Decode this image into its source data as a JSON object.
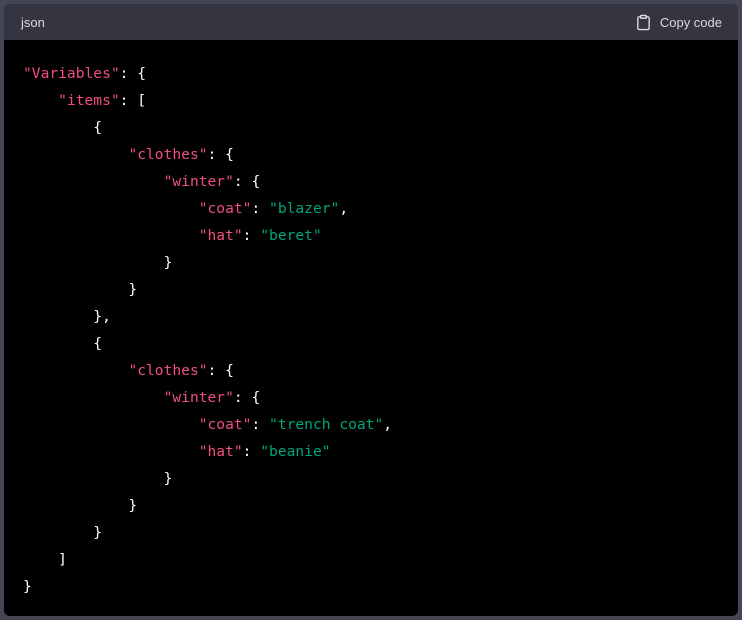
{
  "header": {
    "language": "json",
    "copy_label": "Copy code"
  },
  "icons": {
    "copy": "clipboard-icon"
  },
  "colors": {
    "key": "#ef4f7c",
    "string": "#00a67d",
    "punctuation": "#ffffff",
    "code_background": "#000000",
    "header_background": "#343541"
  },
  "code": {
    "lines": [
      [
        {
          "t": "k",
          "v": "\"Variables\""
        },
        {
          "t": "p",
          "v": ": {"
        }
      ],
      [
        {
          "t": "p",
          "v": "    "
        },
        {
          "t": "k",
          "v": "\"items\""
        },
        {
          "t": "p",
          "v": ": ["
        }
      ],
      [
        {
          "t": "p",
          "v": "        {"
        }
      ],
      [
        {
          "t": "p",
          "v": "            "
        },
        {
          "t": "k",
          "v": "\"clothes\""
        },
        {
          "t": "p",
          "v": ": {"
        }
      ],
      [
        {
          "t": "p",
          "v": "                "
        },
        {
          "t": "k",
          "v": "\"winter\""
        },
        {
          "t": "p",
          "v": ": {"
        }
      ],
      [
        {
          "t": "p",
          "v": "                    "
        },
        {
          "t": "k",
          "v": "\"coat\""
        },
        {
          "t": "p",
          "v": ": "
        },
        {
          "t": "s",
          "v": "\"blazer\""
        },
        {
          "t": "p",
          "v": ","
        }
      ],
      [
        {
          "t": "p",
          "v": "                    "
        },
        {
          "t": "k",
          "v": "\"hat\""
        },
        {
          "t": "p",
          "v": ": "
        },
        {
          "t": "s",
          "v": "\"beret\""
        }
      ],
      [
        {
          "t": "p",
          "v": "                }"
        }
      ],
      [
        {
          "t": "p",
          "v": "            }"
        }
      ],
      [
        {
          "t": "p",
          "v": "        },"
        }
      ],
      [
        {
          "t": "p",
          "v": "        {"
        }
      ],
      [
        {
          "t": "p",
          "v": "            "
        },
        {
          "t": "k",
          "v": "\"clothes\""
        },
        {
          "t": "p",
          "v": ": {"
        }
      ],
      [
        {
          "t": "p",
          "v": "                "
        },
        {
          "t": "k",
          "v": "\"winter\""
        },
        {
          "t": "p",
          "v": ": {"
        }
      ],
      [
        {
          "t": "p",
          "v": "                    "
        },
        {
          "t": "k",
          "v": "\"coat\""
        },
        {
          "t": "p",
          "v": ": "
        },
        {
          "t": "s",
          "v": "\"trench coat\""
        },
        {
          "t": "p",
          "v": ","
        }
      ],
      [
        {
          "t": "p",
          "v": "                    "
        },
        {
          "t": "k",
          "v": "\"hat\""
        },
        {
          "t": "p",
          "v": ": "
        },
        {
          "t": "s",
          "v": "\"beanie\""
        }
      ],
      [
        {
          "t": "p",
          "v": "                }"
        }
      ],
      [
        {
          "t": "p",
          "v": "            }"
        }
      ],
      [
        {
          "t": "p",
          "v": "        }"
        }
      ],
      [
        {
          "t": "p",
          "v": "    ]"
        }
      ],
      [
        {
          "t": "p",
          "v": "}"
        }
      ]
    ]
  }
}
